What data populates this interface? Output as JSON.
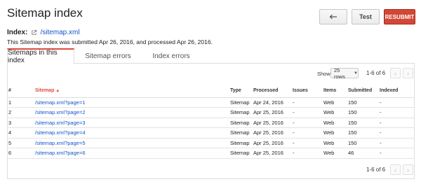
{
  "page": {
    "title": "Sitemap index"
  },
  "toolbar": {
    "test_label": "Test",
    "resubmit_label": "RESUBMIT"
  },
  "index": {
    "label": "Index:",
    "link_text": "/sitemap.xml",
    "submit_info": "This Sitemap index was submitted Apr 26, 2016, and processed Apr 26, 2016."
  },
  "tabs": [
    {
      "label": "Sitemaps in this index"
    },
    {
      "label": "Sitemap errors"
    },
    {
      "label": "Index errors"
    }
  ],
  "pager": {
    "show_label": "Show",
    "rows_value": "25 rows",
    "range_text": "1-6 of 6"
  },
  "table": {
    "headers": {
      "num": "#",
      "sitemap": "Sitemap",
      "type": "Type",
      "processed": "Processed",
      "issues": "Issues",
      "items": "Items",
      "submitted": "Submitted",
      "indexed": "Indexed"
    },
    "rows": [
      {
        "num": "1",
        "sitemap": "/sitemap.xml?page=1",
        "type": "Sitemap",
        "processed": "Apr 24, 2016",
        "issues": "-",
        "items": "Web",
        "submitted": "150",
        "indexed": "-"
      },
      {
        "num": "2",
        "sitemap": "/sitemap.xml?page=2",
        "type": "Sitemap",
        "processed": "Apr 25, 2016",
        "issues": "-",
        "items": "Web",
        "submitted": "150",
        "indexed": "-"
      },
      {
        "num": "3",
        "sitemap": "/sitemap.xml?page=3",
        "type": "Sitemap",
        "processed": "Apr 25, 2016",
        "issues": "-",
        "items": "Web",
        "submitted": "150",
        "indexed": "-"
      },
      {
        "num": "4",
        "sitemap": "/sitemap.xml?page=4",
        "type": "Sitemap",
        "processed": "Apr 25, 2016",
        "issues": "-",
        "items": "Web",
        "submitted": "150",
        "indexed": "-"
      },
      {
        "num": "5",
        "sitemap": "/sitemap.xml?page=5",
        "type": "Sitemap",
        "processed": "Apr 25, 2016",
        "issues": "-",
        "items": "Web",
        "submitted": "150",
        "indexed": "-"
      },
      {
        "num": "6",
        "sitemap": "/sitemap.xml?page=6",
        "type": "Sitemap",
        "processed": "Apr 25, 2016",
        "issues": "-",
        "items": "Web",
        "submitted": "46",
        "indexed": "-"
      }
    ]
  },
  "icons": {
    "back": "undo-arrow-icon",
    "external": "external-link-icon",
    "sort": "sort-up-icon",
    "prev": "chevron-left-icon",
    "next": "chevron-right-icon"
  },
  "colors": {
    "accent_red": "#dd4b39",
    "link_blue": "#1155cc",
    "resubmit_bg": "#d14836"
  }
}
